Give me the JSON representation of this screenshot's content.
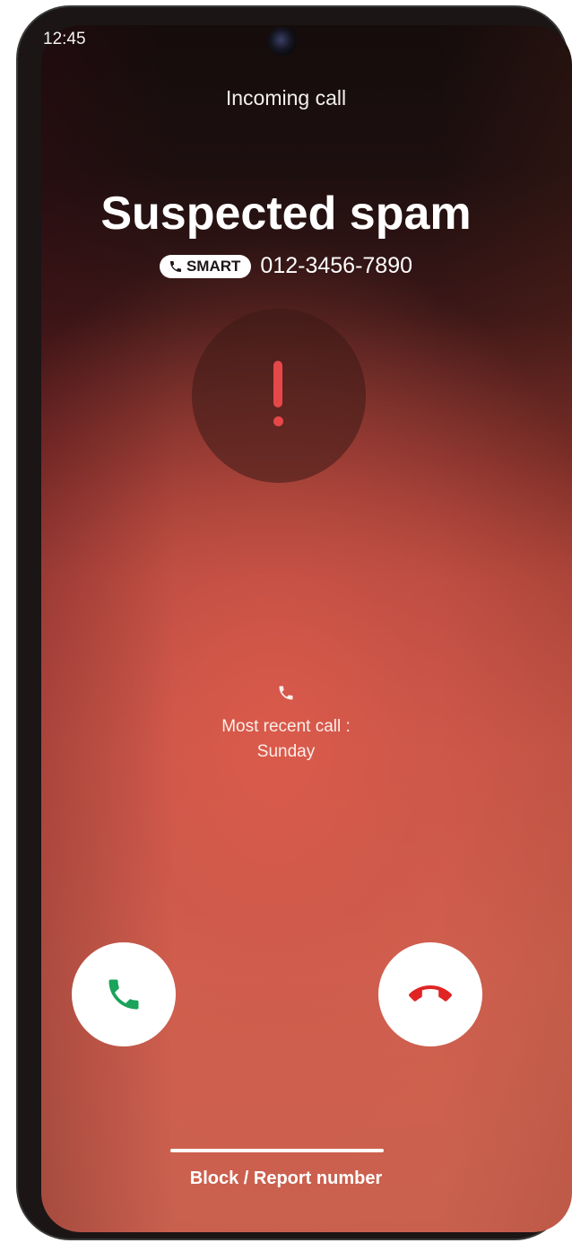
{
  "status_bar": {
    "time": "12:45"
  },
  "call": {
    "status": "Incoming call",
    "caller_label": "Suspected spam",
    "badge_text": "SMART",
    "phone_number": "012-3456-7890",
    "warning_icon": "exclamation-icon"
  },
  "recent_call": {
    "icon": "phone-icon",
    "label": "Most recent call :",
    "day": "Sunday"
  },
  "actions": {
    "accept_icon": "phone-accept-icon",
    "decline_icon": "phone-decline-icon",
    "block_report_label": "Block / Report number"
  },
  "colors": {
    "accept": "#1aa35a",
    "decline": "#e02424",
    "warning": "#e6484a"
  }
}
